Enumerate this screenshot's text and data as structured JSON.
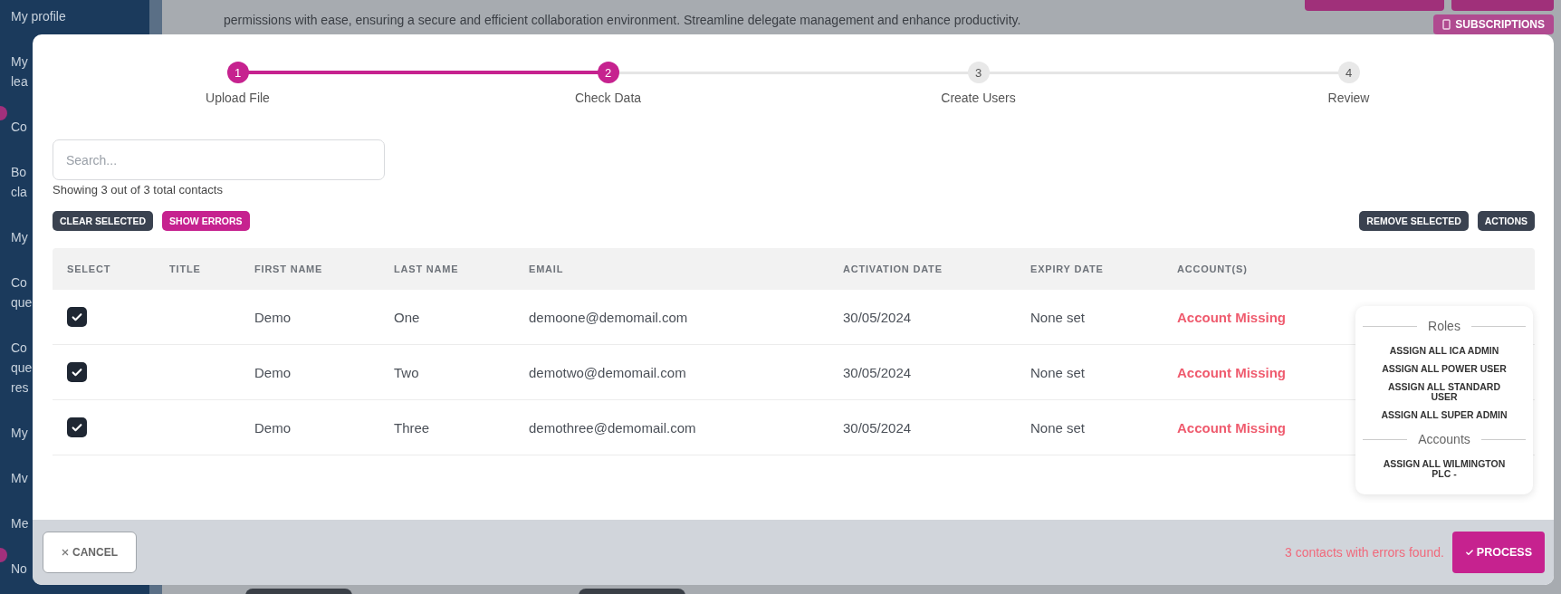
{
  "sidebar": {
    "items": [
      {
        "lines": [
          "My profile"
        ],
        "badge": false
      },
      {
        "lines": [
          "My",
          "lea"
        ],
        "badge": false
      },
      {
        "lines": [
          "Co"
        ],
        "badge": true
      },
      {
        "lines": [
          "Bo",
          "cla"
        ],
        "badge": false
      },
      {
        "lines": [
          "My"
        ],
        "badge": false
      },
      {
        "lines": [
          "Co",
          "que"
        ],
        "badge": false
      },
      {
        "lines": [
          "Co",
          "que",
          "res"
        ],
        "badge": false
      },
      {
        "lines": [
          "My"
        ],
        "badge": false
      },
      {
        "lines": [
          "Mv"
        ],
        "badge": false
      },
      {
        "lines": [
          "Me"
        ],
        "badge": false
      },
      {
        "lines": [
          "No"
        ],
        "badge": true
      }
    ]
  },
  "intro_text": "permissions with ease, ensuring a secure and efficient collaboration environment. Streamline delegate management and enhance productivity.",
  "subscriptions_button": "SUBSCRIPTIONS",
  "modal": {
    "steps": [
      {
        "number": "1",
        "label": "Upload File",
        "completed": true
      },
      {
        "number": "2",
        "label": "Check Data",
        "completed": true
      },
      {
        "number": "3",
        "label": "Create Users",
        "completed": false
      },
      {
        "number": "4",
        "label": "Review",
        "completed": false
      }
    ],
    "search": {
      "placeholder": "Search..."
    },
    "count_text": "Showing 3 out of 3 total contacts",
    "left_buttons": [
      {
        "label": "CLEAR SELECTED",
        "kind": "dark"
      },
      {
        "label": "SHOW ERRORS",
        "kind": "primary"
      }
    ],
    "right_buttons": [
      {
        "label": "REMOVE SELECTED",
        "kind": "dark"
      },
      {
        "label": "ACTIONS",
        "kind": "dark"
      }
    ],
    "table": {
      "columns": [
        "SELECT",
        "TITLE",
        "FIRST NAME",
        "LAST NAME",
        "EMAIL",
        "ACTIVATION DATE",
        "EXPIRY DATE",
        "ACCOUNT(S)"
      ],
      "rows": [
        {
          "selected": true,
          "first_name": "Demo",
          "last_name": "One",
          "email": "demoone@demomail.com",
          "activation_date": "30/05/2024",
          "expiry_date": "None set",
          "account": "Account Missing",
          "error": true
        },
        {
          "selected": true,
          "first_name": "Demo",
          "last_name": "Two",
          "email": "demotwo@demomail.com",
          "activation_date": "30/05/2024",
          "expiry_date": "None set",
          "account": "Account Missing",
          "error": true
        },
        {
          "selected": true,
          "first_name": "Demo",
          "last_name": "Three",
          "email": "demothree@demomail.com",
          "activation_date": "30/05/2024",
          "expiry_date": "None set",
          "account": "Account Missing",
          "error": true
        }
      ]
    },
    "actions_menu": {
      "sections": [
        {
          "heading": "Roles",
          "items": [
            "ASSIGN ALL ICA ADMIN",
            "ASSIGN ALL POWER USER",
            "ASSIGN ALL STANDARD USER",
            "ASSIGN ALL SUPER ADMIN"
          ]
        },
        {
          "heading": "Accounts",
          "items": [
            "ASSIGN ALL WILMINGTON PLC -"
          ]
        }
      ]
    },
    "footer": {
      "cancel": "CANCEL",
      "error_message": "3 contacts with errors found.",
      "process": "PROCESS"
    }
  }
}
